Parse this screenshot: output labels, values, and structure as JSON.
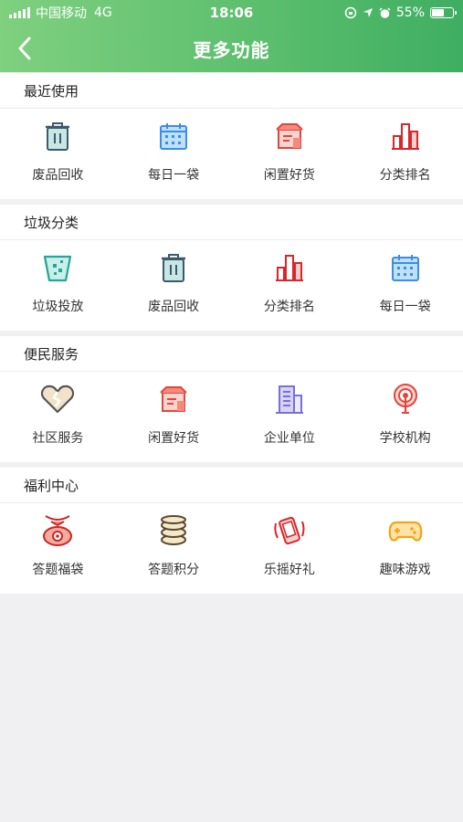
{
  "status": {
    "carrier": "中国移动",
    "network": "4G",
    "time": "18:06",
    "battery": "55%",
    "battery_level": 0.55
  },
  "nav": {
    "title": "更多功能"
  },
  "sections": [
    {
      "title": "最近使用",
      "items": [
        {
          "label": "废品回收",
          "icon": "trash-bin-icon"
        },
        {
          "label": "每日一袋",
          "icon": "calendar-icon"
        },
        {
          "label": "闲置好货",
          "icon": "shop-box-icon"
        },
        {
          "label": "分类排名",
          "icon": "bar-chart-icon"
        }
      ]
    },
    {
      "title": "垃圾分类",
      "items": [
        {
          "label": "垃圾投放",
          "icon": "dump-bucket-icon"
        },
        {
          "label": "废品回收",
          "icon": "trash-bin-icon"
        },
        {
          "label": "分类排名",
          "icon": "bar-chart-icon"
        },
        {
          "label": "每日一袋",
          "icon": "calendar-icon"
        }
      ]
    },
    {
      "title": "便民服务",
      "items": [
        {
          "label": "社区服务",
          "icon": "heart-icon"
        },
        {
          "label": "闲置好货",
          "icon": "shop-box-icon"
        },
        {
          "label": "企业单位",
          "icon": "building-icon"
        },
        {
          "label": "学校机构",
          "icon": "broadcast-pin-icon"
        }
      ]
    },
    {
      "title": "福利中心",
      "items": [
        {
          "label": "答题福袋",
          "icon": "lucky-bag-icon"
        },
        {
          "label": "答题积分",
          "icon": "coin-stack-icon"
        },
        {
          "label": "乐摇好礼",
          "icon": "shake-phone-icon"
        },
        {
          "label": "趣味游戏",
          "icon": "gamepad-icon"
        }
      ]
    }
  ]
}
